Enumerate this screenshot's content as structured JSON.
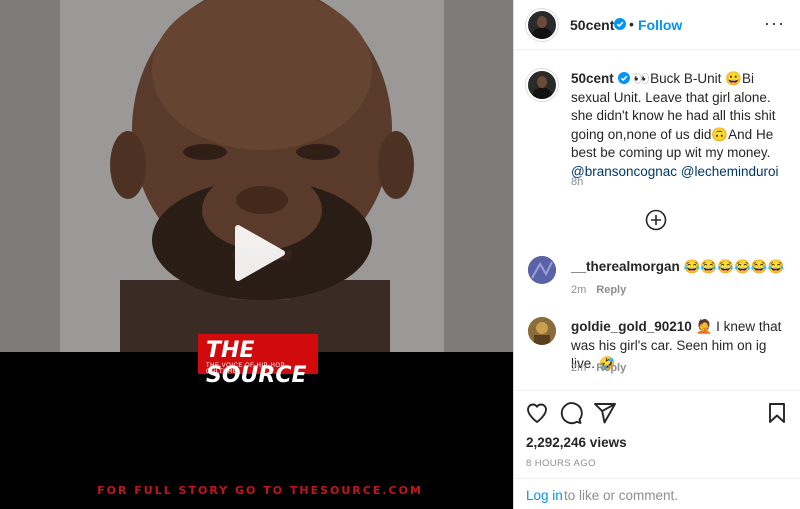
{
  "post": {
    "author": "50cent",
    "follow_label": "Follow",
    "dot": "•",
    "more": "···"
  },
  "media": {
    "brand": "THE SOURCE",
    "brand_tagline": "THE VOICE OF HIP-HOP CULTURE",
    "footer": "FOR FULL STORY GO TO THESOURCE.COM"
  },
  "caption": {
    "author": "50cent",
    "text": "👀Buck B-Unit 😀Bi sexual Unit. Leave that girl alone. she didn't know he had all this shit going on,none of us did🙃And He best be coming up wit my money.",
    "mention1": "@bransoncognac",
    "mention2": "@lecheminduroi",
    "time": "8h"
  },
  "comments": [
    {
      "author": "__therealmorgan",
      "text": "😂😂😂😂😂😂",
      "time": "2m",
      "reply": "Reply"
    },
    {
      "author": "goldie_gold_90210",
      "text": "🤦 I knew that was his girl's car. Seen him on ig live. 🤣",
      "time": "2m",
      "reply": "Reply"
    }
  ],
  "stats": {
    "views": "2,292,246 views",
    "posted": "8 HOURS AGO"
  },
  "login": {
    "link": "Log in",
    "rest": "to like or comment."
  },
  "colors": {
    "accent": "#0095f6",
    "brand_red": "#d10a0e",
    "muted": "#8e8e8e"
  },
  "icons": [
    "play-icon",
    "verified-badge-icon",
    "more-options-icon",
    "add-comment-icon",
    "heart-icon",
    "comment-icon",
    "share-icon",
    "bookmark-icon"
  ]
}
